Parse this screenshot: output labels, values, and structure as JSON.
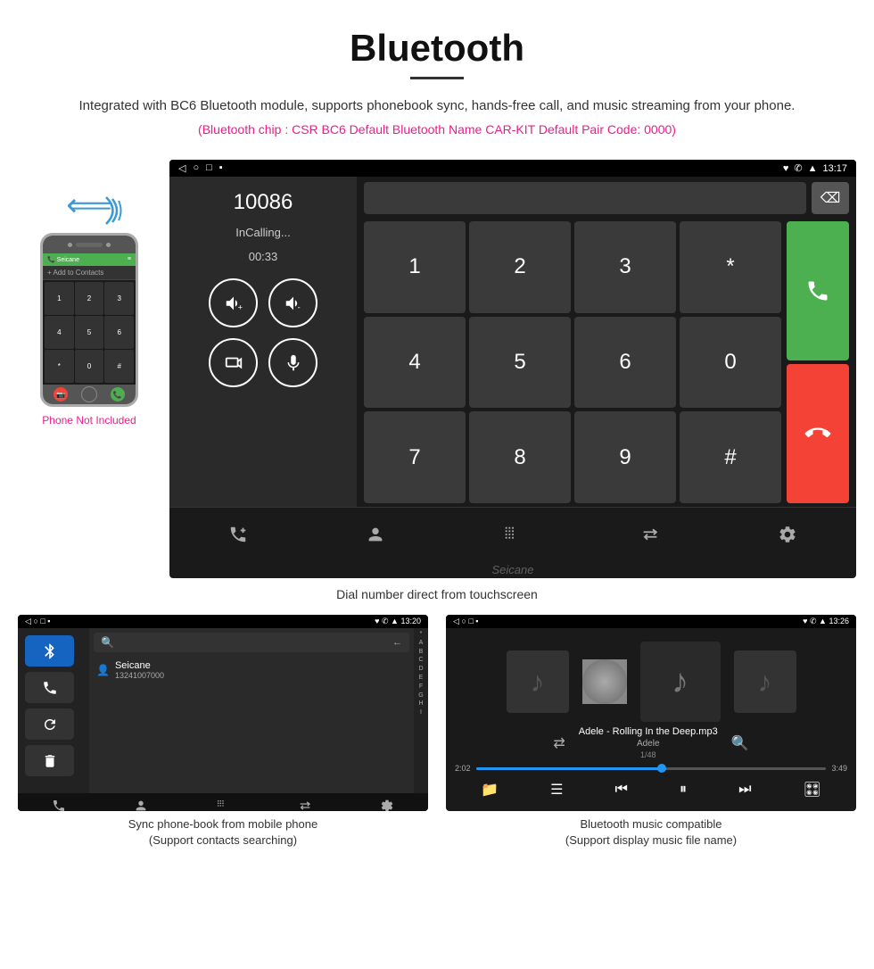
{
  "header": {
    "title": "Bluetooth",
    "subtitle": "Integrated with BC6 Bluetooth module, supports phonebook sync, hands-free call, and music streaming from your phone.",
    "specs": "(Bluetooth chip : CSR BC6    Default Bluetooth Name CAR-KIT    Default Pair Code: 0000)"
  },
  "phone_label": "Phone Not Included",
  "main_screen": {
    "status_time": "13:17",
    "status_icons": "♥ ✆ ▲",
    "phone_number": "10086",
    "incalling": "InCalling...",
    "timer": "00:33",
    "keys": [
      "1",
      "2",
      "3",
      "*",
      "4",
      "5",
      "6",
      "0",
      "7",
      "8",
      "9",
      "#"
    ],
    "caption": "Dial number direct from touchscreen"
  },
  "bottom_left": {
    "status_time": "13:20",
    "contact_name": "Seicane",
    "contact_number": "13241007000",
    "alphabet": [
      "*",
      "A",
      "B",
      "C",
      "D",
      "E",
      "F",
      "G",
      "H",
      "I"
    ],
    "caption_line1": "Sync phone-book from mobile phone",
    "caption_line2": "(Support contacts searching)"
  },
  "bottom_right": {
    "status_time": "13:26",
    "song_title": "Adele - Rolling In the Deep.mp3",
    "artist": "Adele",
    "track_num": "1/48",
    "time_elapsed": "2:02",
    "time_total": "3:49",
    "progress_pct": 53,
    "caption_line1": "Bluetooth music compatible",
    "caption_line2": "(Support display music file name)"
  },
  "toolbar": {
    "icons": [
      "↙✆",
      "👤",
      "⠿",
      "📱",
      "⚙"
    ]
  }
}
